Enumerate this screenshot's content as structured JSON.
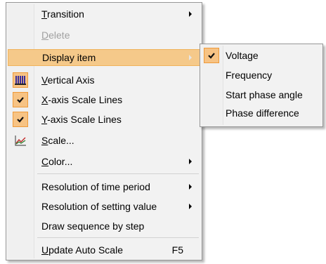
{
  "main_menu": {
    "items": [
      {
        "label": "Transition",
        "mnemonic": "T",
        "rest": "ransition",
        "has_submenu": true
      },
      {
        "label": "Delete",
        "mnemonic": "D",
        "rest": "elete",
        "disabled": true
      },
      {
        "label": "Display item",
        "has_submenu": true,
        "highlighted": true
      },
      {
        "label": "Vertical Axis",
        "mnemonic": "V",
        "rest": "ertical Axis",
        "icon": "vertical-axis-icon"
      },
      {
        "label": "X-axis Scale Lines",
        "mnemonic": "X",
        "rest": "-axis Scale Lines",
        "checked": true
      },
      {
        "label": "Y-axis Scale Lines",
        "mnemonic": "Y",
        "rest": "-axis Scale Lines",
        "checked": true
      },
      {
        "label": "Scale...",
        "mnemonic": "S",
        "rest": "cale...",
        "icon": "scale-chart-icon"
      },
      {
        "label": "Color...",
        "mnemonic": "C",
        "rest": "olor...",
        "has_submenu": true
      },
      {
        "label": "Resolution of time period",
        "has_submenu": true
      },
      {
        "label": "Resolution of setting value",
        "has_submenu": true
      },
      {
        "label": "Draw sequence by step"
      },
      {
        "label": "Update Auto Scale",
        "mnemonic": "U",
        "rest": "pdate Auto Scale",
        "shortcut": "F5"
      }
    ]
  },
  "display_item_submenu": {
    "items": [
      {
        "label": "Voltage",
        "checked": true
      },
      {
        "label": "Frequency"
      },
      {
        "label": "Start phase angle"
      },
      {
        "label": "Phase difference"
      }
    ]
  },
  "colors": {
    "menu_bg": "#f2f2f2",
    "highlight": "#f5c98a",
    "check_bg": "#f7c384",
    "check_border": "#ee9a3a",
    "disabled_text": "#a0a0a0"
  }
}
